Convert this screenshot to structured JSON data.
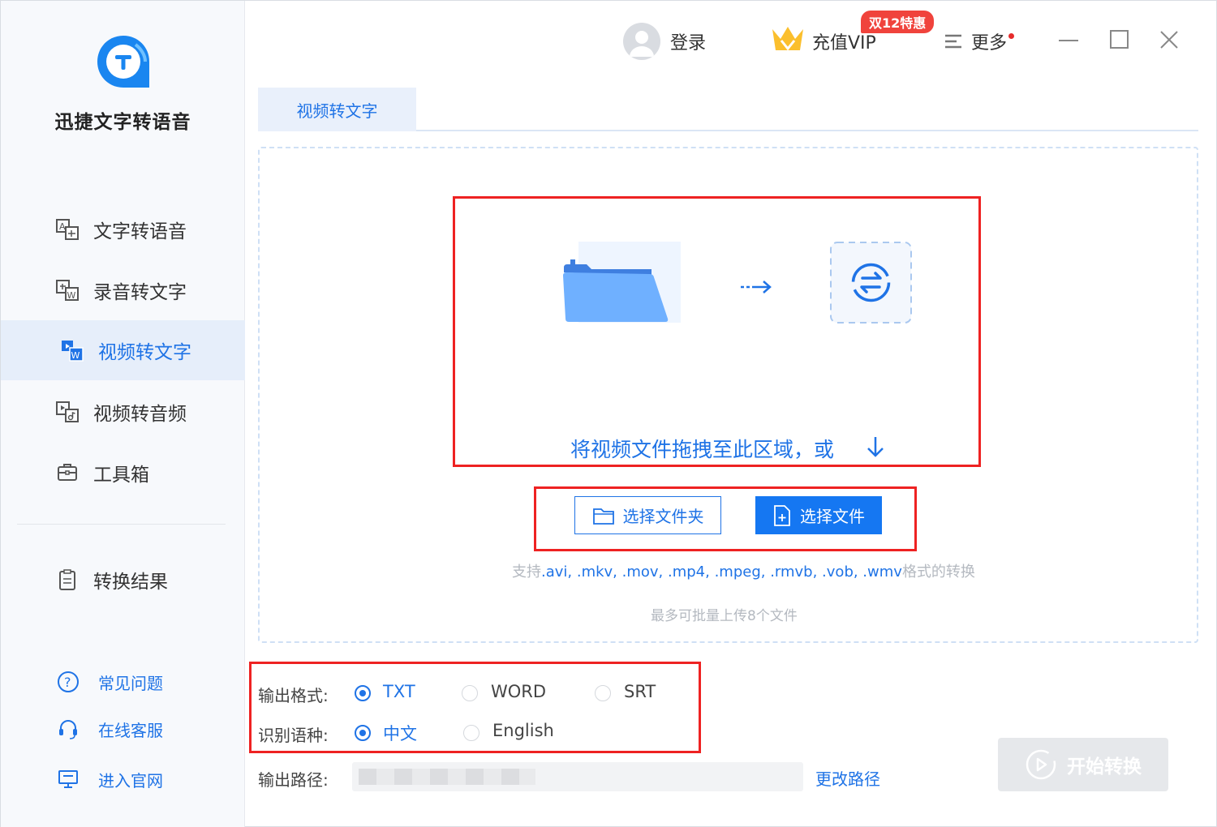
{
  "app": {
    "name": "迅捷文字转语音"
  },
  "nav": {
    "items": [
      {
        "label": "文字转语音",
        "icon": "text-to-speech-icon"
      },
      {
        "label": "录音转文字",
        "icon": "audio-to-text-icon"
      },
      {
        "label": "视频转文字",
        "icon": "video-to-text-icon",
        "active": true
      },
      {
        "label": "视频转音频",
        "icon": "video-to-audio-icon"
      },
      {
        "label": "工具箱",
        "icon": "toolbox-icon"
      }
    ],
    "results": {
      "label": "转换结果",
      "icon": "clipboard-icon"
    }
  },
  "footer": {
    "faq": "常见问题",
    "support": "在线客服",
    "website": "进入官网"
  },
  "topbar": {
    "login": "登录",
    "vip": "充值VIP",
    "vip_badge": "双12特惠",
    "more": "更多"
  },
  "tab": {
    "label": "视频转文字"
  },
  "dropzone": {
    "prompt": "将视频文件拖拽至此区域，或",
    "select_folder": "选择文件夹",
    "select_file": "选择文件",
    "support_prefix": "支持",
    "support_formats": ".avi, .mkv, .mov, .mp4, .mpeg, .rmvb, .vob, .wmv",
    "support_suffix": "格式的转换",
    "max_note": "最多可批量上传8个文件"
  },
  "options": {
    "format_label": "输出格式:",
    "formats": [
      "TXT",
      "WORD",
      "SRT"
    ],
    "format_selected": "TXT",
    "language_label": "识别语种:",
    "languages": [
      "中文",
      "English"
    ],
    "language_selected": "中文",
    "path_label": "输出路径:",
    "change_path": "更改路径"
  },
  "start_button": "开始转换",
  "colors": {
    "accent": "#1f73e6",
    "highlight": "#ee2222",
    "badge": "#f0433c"
  }
}
